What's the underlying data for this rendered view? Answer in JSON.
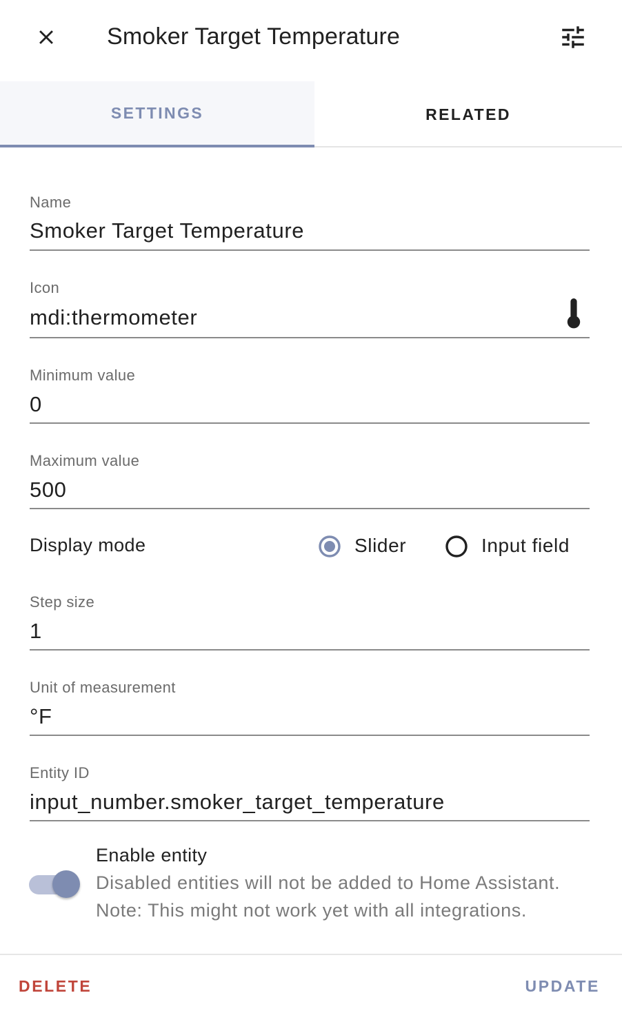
{
  "header": {
    "title": "Smoker Target Temperature",
    "close_icon": "close-icon",
    "settings_icon": "tune-icon"
  },
  "tabs": [
    {
      "label": "SETTINGS",
      "active": true
    },
    {
      "label": "RELATED",
      "active": false
    }
  ],
  "fields": {
    "name": {
      "label": "Name",
      "value": "Smoker Target Temperature"
    },
    "icon": {
      "label": "Icon",
      "value": "mdi:thermometer",
      "icon": "thermometer-icon"
    },
    "min": {
      "label": "Minimum value",
      "value": "0"
    },
    "max": {
      "label": "Maximum value",
      "value": "500"
    },
    "step": {
      "label": "Step size",
      "value": "1"
    },
    "unit": {
      "label": "Unit of measurement",
      "value": "°F"
    },
    "entity_id": {
      "label": "Entity ID",
      "value": "input_number.smoker_target_temperature"
    }
  },
  "display_mode": {
    "label": "Display mode",
    "options": [
      {
        "label": "Slider",
        "selected": true
      },
      {
        "label": "Input field",
        "selected": false
      }
    ]
  },
  "enable_entity": {
    "label": "Enable entity",
    "enabled": true,
    "description_line1": "Disabled entities will not be added to Home Assistant.",
    "description_line2": "Note: This might not work yet with all integrations."
  },
  "footer": {
    "delete_label": "DELETE",
    "update_label": "UPDATE"
  },
  "colors": {
    "accent": "#7e8cb1",
    "danger": "#c0453a"
  }
}
